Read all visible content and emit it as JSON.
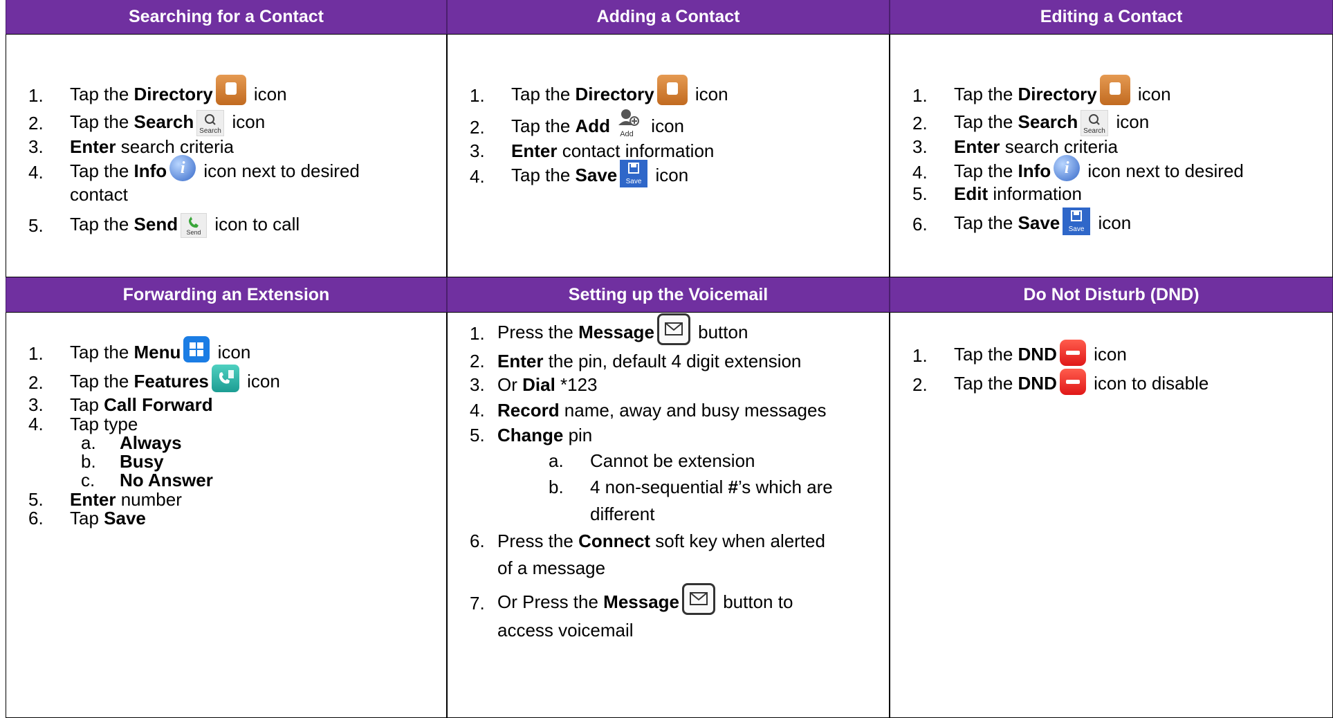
{
  "headers": {
    "search": "Searching for a Contact",
    "add": "Adding a Contact",
    "edit": "Editing a Contact",
    "forward": "Forwarding an Extension",
    "voicemail": "Setting up the Voicemail",
    "dnd": "Do Not Disturb (DND)"
  },
  "search": {
    "s1": {
      "n": "1.",
      "a": "Tap the ",
      "b": "Directory",
      "c": " icon"
    },
    "s2": {
      "n": "2.",
      "a": "Tap the ",
      "b": "Search",
      "c": " icon"
    },
    "s3": {
      "n": "3.",
      "b": "Enter",
      "c": " search criteria"
    },
    "s4": {
      "n": "4.",
      "a": "Tap the ",
      "b": "Info",
      "c": " icon next to desired",
      "d": "contact"
    },
    "s5": {
      "n": "5.",
      "a": "Tap the ",
      "b": "Send",
      "c": " icon to call"
    }
  },
  "add": {
    "s1": {
      "n": "1.",
      "a": "Tap the ",
      "b": "Directory",
      "c": " icon"
    },
    "s2": {
      "n": "2.",
      "a": "Tap the ",
      "b": "Add",
      "c": " icon"
    },
    "s3": {
      "n": "3.",
      "b": "Enter",
      "c": " contact information"
    },
    "s4": {
      "n": "4.",
      "a": "Tap the ",
      "b": "Save",
      "c": " icon"
    }
  },
  "edit": {
    "s1": {
      "n": "1.",
      "a": "Tap the ",
      "b": "Directory",
      "c": " icon"
    },
    "s2": {
      "n": "2.",
      "a": "Tap the ",
      "b": "Search",
      "c": " icon"
    },
    "s3": {
      "n": "3.",
      "b": "Enter",
      "c": " search criteria"
    },
    "s4": {
      "n": "4.",
      "a": "Tap the ",
      "b": "Info",
      "c": " icon next to desired"
    },
    "s5": {
      "n": "5.",
      "b": "Edit",
      "c": " information"
    },
    "s6": {
      "n": "6.",
      "a": "Tap the ",
      "b": "Save",
      "c": " icon"
    }
  },
  "forward": {
    "s1": {
      "n": "1.",
      "a": "Tap the ",
      "b": "Menu",
      "c": " icon"
    },
    "s2": {
      "n": "2.",
      "a": "Tap the ",
      "b": "Features",
      "c": " icon"
    },
    "s3": {
      "n": "3.",
      "a": "Tap ",
      "b": "Call Forward"
    },
    "s4": {
      "n": "4.",
      "a": "Tap type"
    },
    "s4a": {
      "n": "a.",
      "b": "Always"
    },
    "s4b": {
      "n": "b.",
      "b": "Busy"
    },
    "s4c": {
      "n": "c.",
      "b": "No Answer"
    },
    "s5": {
      "n": "5.",
      "b": "Enter",
      "c": " number"
    },
    "s6": {
      "n": "6.",
      "a": "Tap ",
      "b": "Save"
    }
  },
  "voicemail": {
    "s1": {
      "n": "1.",
      "a": "Press the ",
      "b": "Message",
      "c": " button"
    },
    "s2": {
      "n": "2.",
      "b": "Enter",
      "c": " the pin, default 4 digit extension"
    },
    "s3": {
      "n": "3.",
      "a": "Or ",
      "b": "Dial",
      "c": " *123"
    },
    "s4": {
      "n": "4.",
      "b": "Record",
      "c": " name, away and busy messages"
    },
    "s5": {
      "n": "5.",
      "b": "Change",
      "c": " pin"
    },
    "s5a": {
      "n": "a.",
      "a": "Cannot be extension"
    },
    "s5b": {
      "n": "b.",
      "a": "4 non-sequential ",
      "b": "#",
      "c": "’s which are",
      "d": "different"
    },
    "s6": {
      "n": "6.",
      "a": "Press the ",
      "b": "Connect",
      "c": " soft key when alerted",
      "d": "of a message"
    },
    "s7": {
      "n": "7.",
      "a": "Or Press the ",
      "b": "Message",
      "c": " button to",
      "d": "access voicemail"
    }
  },
  "dnd": {
    "s1": {
      "n": "1.",
      "a": "Tap the ",
      "b": "DND",
      "c": " icon"
    },
    "s2": {
      "n": "2.",
      "a": "Tap the ",
      "b": "DND",
      "c": " icon to disable"
    }
  },
  "icon_labels": {
    "search": "Search",
    "add": "Add",
    "send": "Send",
    "save": "Save"
  },
  "colors": {
    "header_bg": "#7030a0",
    "header_text": "#ffffff"
  }
}
